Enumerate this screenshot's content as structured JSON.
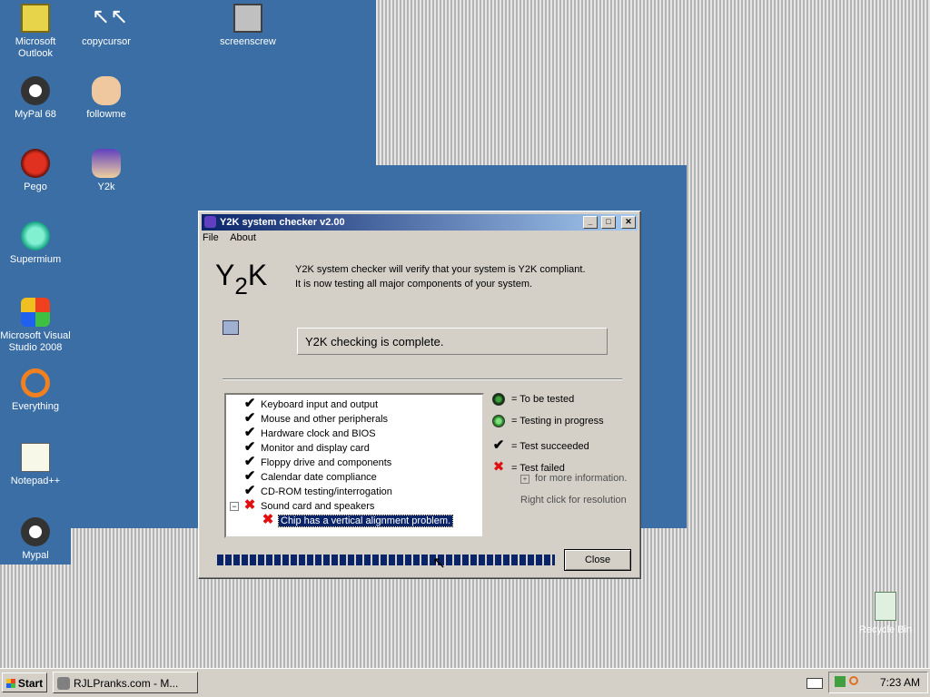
{
  "desktop": {
    "icons": [
      {
        "name": "microsoft-outlook-icon",
        "label": "Microsoft Outlook"
      },
      {
        "name": "copycursor-icon",
        "label": "copycursor"
      },
      {
        "name": "screenscrew-icon",
        "label": "screenscrew"
      },
      {
        "name": "mypal68-icon",
        "label": "MyPal 68"
      },
      {
        "name": "followme-icon",
        "label": "followme"
      },
      {
        "name": "pego-icon",
        "label": "Pego"
      },
      {
        "name": "y2k-icon",
        "label": "Y2k"
      },
      {
        "name": "supermium-icon",
        "label": "Supermium"
      },
      {
        "name": "visual-studio-icon",
        "label": "Microsoft Visual Studio 2008"
      },
      {
        "name": "everything-icon",
        "label": "Everything"
      },
      {
        "name": "notepadpp-icon",
        "label": "Notepad++"
      },
      {
        "name": "mypal-icon",
        "label": "Mypal"
      },
      {
        "name": "recycle-bin-icon",
        "label": "Recycle Bin"
      }
    ]
  },
  "window": {
    "title": "Y2K system checker v2.00",
    "menu": [
      "File",
      "About"
    ],
    "logo": "Y2K",
    "description_line1": "Y2K system checker will verify that your system is Y2K compliant.",
    "description_line2": "It is now testing all major components of your system.",
    "status": "Y2K checking is complete.",
    "tests": [
      {
        "label": "Keyboard input and output",
        "result": "ok"
      },
      {
        "label": "Mouse and other peripherals",
        "result": "ok"
      },
      {
        "label": "Hardware clock and BIOS",
        "result": "ok"
      },
      {
        "label": "Monitor and display card",
        "result": "ok"
      },
      {
        "label": "Floppy drive and components",
        "result": "ok"
      },
      {
        "label": "Calendar date compliance",
        "result": "ok"
      },
      {
        "label": "CD-ROM testing/interrogation",
        "result": "ok"
      },
      {
        "label": "Sound card and speakers",
        "result": "failed"
      }
    ],
    "sub_item": "Chip has a vertical alignment problem.",
    "legend": {
      "to_be_tested": "= To be tested",
      "in_progress": "= Testing in progress",
      "succeeded": "= Test succeeded",
      "failed": "= Test failed",
      "more_info": "for more information.",
      "right_click": "Right click for resolution"
    },
    "close_label": "Close",
    "progress": 1.0
  },
  "taskbar": {
    "start_label": "Start",
    "task_label": "RJLPranks.com - M...",
    "clock": "7:23 AM"
  }
}
